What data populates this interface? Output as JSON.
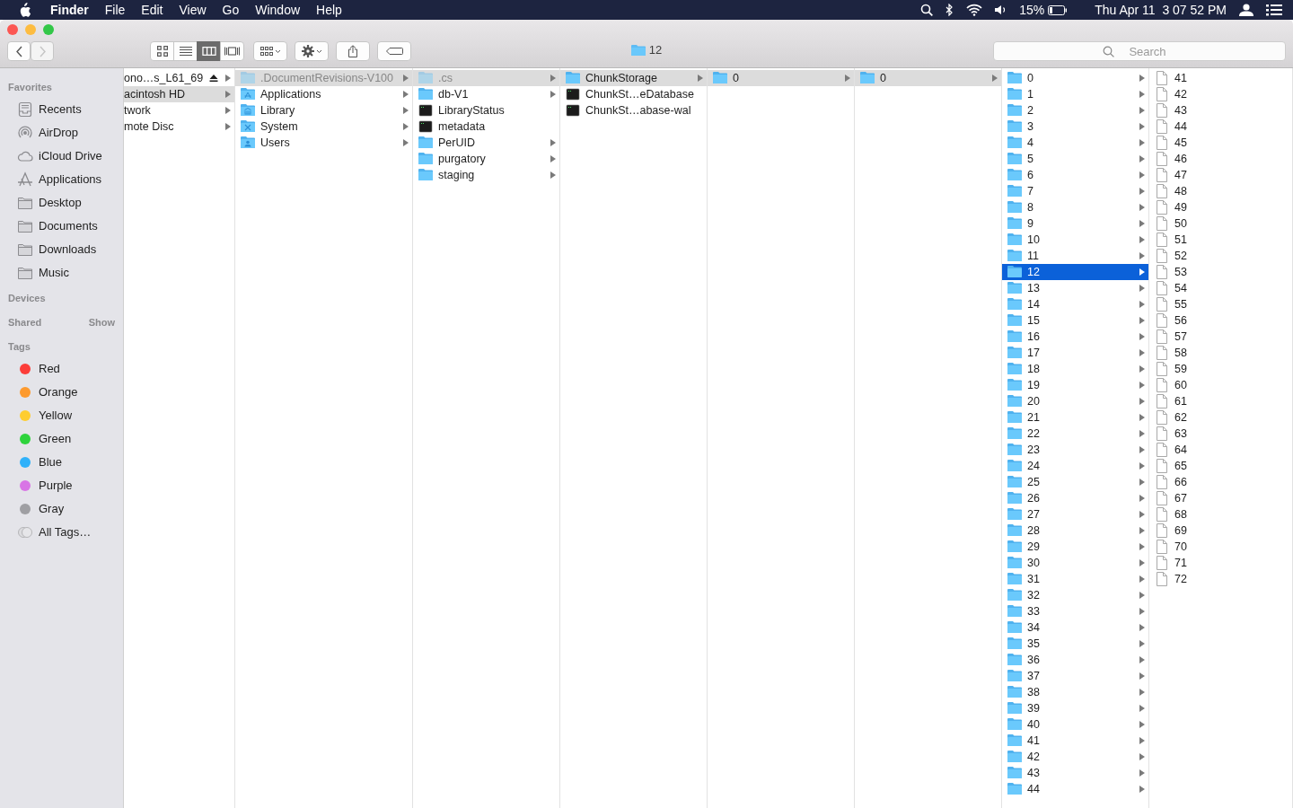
{
  "menu_bar": {
    "app": "Finder",
    "menus": [
      "File",
      "Edit",
      "View",
      "Go",
      "Window",
      "Help"
    ],
    "battery_percent": "15%",
    "clock": "Thu Apr 11  3 07 52 PM"
  },
  "window": {
    "title": "12",
    "nav_buttons": [
      {
        "kind": "back",
        "disabled": false
      },
      {
        "kind": "forward",
        "disabled": true
      }
    ],
    "view_modes": [
      {
        "kind": "icon",
        "selected": false
      },
      {
        "kind": "list",
        "selected": false
      },
      {
        "kind": "column",
        "selected": true
      },
      {
        "kind": "cover",
        "selected": false
      }
    ],
    "search": {
      "placeholder": "Search"
    }
  },
  "sidebar": {
    "sections": [
      {
        "title": "Favorites",
        "items": [
          {
            "label": "Recents",
            "kind": "recents"
          },
          {
            "label": "AirDrop",
            "kind": "airdrop"
          },
          {
            "label": "iCloud Drive",
            "kind": "cloud"
          },
          {
            "label": "Applications",
            "kind": "apps"
          },
          {
            "label": "Desktop",
            "kind": "folder"
          },
          {
            "label": "Documents",
            "kind": "folder"
          },
          {
            "label": "Downloads",
            "kind": "folder"
          },
          {
            "label": "Music",
            "kind": "folder"
          }
        ]
      },
      {
        "title": "Devices"
      },
      {
        "title": "Shared",
        "action": "Show"
      },
      {
        "title": "Tags",
        "items": [
          {
            "label": "Red",
            "kind": "tag",
            "color": "#fc3d39"
          },
          {
            "label": "Orange",
            "kind": "tag",
            "color": "#fd9a2e"
          },
          {
            "label": "Yellow",
            "kind": "tag",
            "color": "#fecd30"
          },
          {
            "label": "Green",
            "kind": "tag",
            "color": "#2ed33c"
          },
          {
            "label": "Blue",
            "kind": "tag",
            "color": "#2fb1fa"
          },
          {
            "label": "Purple",
            "kind": "tag",
            "color": "#d875e5"
          },
          {
            "label": "Gray",
            "kind": "tag",
            "color": "#9f9fa3"
          },
          {
            "label": "All Tags…",
            "kind": "all-tags"
          }
        ]
      }
    ]
  },
  "columns": [
    {
      "active": false,
      "items": [
        {
          "name": "ono…s_L61_69",
          "kind": "volume",
          "arrow": true,
          "selected": false,
          "eject": true
        },
        {
          "name": "acintosh HD",
          "kind": "volume",
          "arrow": true,
          "selected": true,
          "eject": false
        },
        {
          "name": "twork",
          "kind": "volume",
          "arrow": true,
          "selected": false,
          "eject": false
        },
        {
          "name": "mote Disc",
          "kind": "volume",
          "arrow": true,
          "selected": false,
          "eject": false
        }
      ]
    },
    {
      "active": false,
      "items": [
        {
          "name": ".DocumentRevisions-V100",
          "kind": "folder",
          "arrow": true,
          "selected": true,
          "dimmed": true
        },
        {
          "name": "Applications",
          "kind": "apps-folder",
          "arrow": true,
          "selected": false,
          "dimmed": false
        },
        {
          "name": "Library",
          "kind": "library-folder",
          "arrow": true,
          "selected": false,
          "dimmed": false
        },
        {
          "name": "System",
          "kind": "system-folder",
          "arrow": true,
          "selected": false,
          "dimmed": false
        },
        {
          "name": "Users",
          "kind": "users-folder",
          "arrow": true,
          "selected": false,
          "dimmed": false
        }
      ]
    },
    {
      "active": false,
      "items": [
        {
          "name": ".cs",
          "kind": "folder",
          "arrow": true,
          "selected": true,
          "dimmed": true
        },
        {
          "name": "db-V1",
          "kind": "folder",
          "arrow": true,
          "selected": false,
          "dimmed": false
        },
        {
          "name": "LibraryStatus",
          "kind": "exec",
          "arrow": false,
          "selected": false,
          "dimmed": false
        },
        {
          "name": "metadata",
          "kind": "exec",
          "arrow": false,
          "selected": false,
          "dimmed": false
        },
        {
          "name": "PerUID",
          "kind": "folder",
          "arrow": true,
          "selected": false,
          "dimmed": false
        },
        {
          "name": "purgatory",
          "kind": "folder",
          "arrow": true,
          "selected": false,
          "dimmed": false
        },
        {
          "name": "staging",
          "kind": "folder",
          "arrow": true,
          "selected": false,
          "dimmed": false
        }
      ]
    },
    {
      "active": false,
      "items": [
        {
          "name": "ChunkStorage",
          "kind": "folder",
          "arrow": true,
          "selected": true
        },
        {
          "name": "ChunkSt…eDatabase",
          "kind": "exec",
          "arrow": false,
          "selected": false
        },
        {
          "name": "ChunkSt…abase-wal",
          "kind": "exec",
          "arrow": false,
          "selected": false
        }
      ]
    },
    {
      "active": false,
      "items": [
        {
          "name": "0",
          "kind": "folder",
          "arrow": true,
          "selected": true
        }
      ]
    },
    {
      "active": false,
      "items": [
        {
          "name": "0",
          "kind": "folder",
          "arrow": true,
          "selected": true
        }
      ]
    },
    {
      "active": true,
      "items": [
        {
          "name": "0",
          "kind": "folder",
          "arrow": true,
          "selected": false
        },
        {
          "name": "1",
          "kind": "folder",
          "arrow": true,
          "selected": false
        },
        {
          "name": "2",
          "kind": "folder",
          "arrow": true,
          "selected": false
        },
        {
          "name": "3",
          "kind": "folder",
          "arrow": true,
          "selected": false
        },
        {
          "name": "4",
          "kind": "folder",
          "arrow": true,
          "selected": false
        },
        {
          "name": "5",
          "kind": "folder",
          "arrow": true,
          "selected": false
        },
        {
          "name": "6",
          "kind": "folder",
          "arrow": true,
          "selected": false
        },
        {
          "name": "7",
          "kind": "folder",
          "arrow": true,
          "selected": false
        },
        {
          "name": "8",
          "kind": "folder",
          "arrow": true,
          "selected": false
        },
        {
          "name": "9",
          "kind": "folder",
          "arrow": true,
          "selected": false
        },
        {
          "name": "10",
          "kind": "folder",
          "arrow": true,
          "selected": false
        },
        {
          "name": "11",
          "kind": "folder",
          "arrow": true,
          "selected": false
        },
        {
          "name": "12",
          "kind": "folder",
          "arrow": true,
          "selected": true
        },
        {
          "name": "13",
          "kind": "folder",
          "arrow": true,
          "selected": false
        },
        {
          "name": "14",
          "kind": "folder",
          "arrow": true,
          "selected": false
        },
        {
          "name": "15",
          "kind": "folder",
          "arrow": true,
          "selected": false
        },
        {
          "name": "16",
          "kind": "folder",
          "arrow": true,
          "selected": false
        },
        {
          "name": "17",
          "kind": "folder",
          "arrow": true,
          "selected": false
        },
        {
          "name": "18",
          "kind": "folder",
          "arrow": true,
          "selected": false
        },
        {
          "name": "19",
          "kind": "folder",
          "arrow": true,
          "selected": false
        },
        {
          "name": "20",
          "kind": "folder",
          "arrow": true,
          "selected": false
        },
        {
          "name": "21",
          "kind": "folder",
          "arrow": true,
          "selected": false
        },
        {
          "name": "22",
          "kind": "folder",
          "arrow": true,
          "selected": false
        },
        {
          "name": "23",
          "kind": "folder",
          "arrow": true,
          "selected": false
        },
        {
          "name": "24",
          "kind": "folder",
          "arrow": true,
          "selected": false
        },
        {
          "name": "25",
          "kind": "folder",
          "arrow": true,
          "selected": false
        },
        {
          "name": "26",
          "kind": "folder",
          "arrow": true,
          "selected": false
        },
        {
          "name": "27",
          "kind": "folder",
          "arrow": true,
          "selected": false
        },
        {
          "name": "28",
          "kind": "folder",
          "arrow": true,
          "selected": false
        },
        {
          "name": "29",
          "kind": "folder",
          "arrow": true,
          "selected": false
        },
        {
          "name": "30",
          "kind": "folder",
          "arrow": true,
          "selected": false
        },
        {
          "name": "31",
          "kind": "folder",
          "arrow": true,
          "selected": false
        },
        {
          "name": "32",
          "kind": "folder",
          "arrow": true,
          "selected": false
        },
        {
          "name": "33",
          "kind": "folder",
          "arrow": true,
          "selected": false
        },
        {
          "name": "34",
          "kind": "folder",
          "arrow": true,
          "selected": false
        },
        {
          "name": "35",
          "kind": "folder",
          "arrow": true,
          "selected": false
        },
        {
          "name": "36",
          "kind": "folder",
          "arrow": true,
          "selected": false
        },
        {
          "name": "37",
          "kind": "folder",
          "arrow": true,
          "selected": false
        },
        {
          "name": "38",
          "kind": "folder",
          "arrow": true,
          "selected": false
        },
        {
          "name": "39",
          "kind": "folder",
          "arrow": true,
          "selected": false
        },
        {
          "name": "40",
          "kind": "folder",
          "arrow": true,
          "selected": false
        },
        {
          "name": "41",
          "kind": "folder",
          "arrow": true,
          "selected": false
        },
        {
          "name": "42",
          "kind": "folder",
          "arrow": true,
          "selected": false
        },
        {
          "name": "43",
          "kind": "folder",
          "arrow": true,
          "selected": false
        },
        {
          "name": "44",
          "kind": "folder",
          "arrow": true,
          "selected": false
        }
      ]
    },
    {
      "items": [
        {
          "name": "41",
          "kind": "file",
          "arrow": false,
          "selected": false
        },
        {
          "name": "42",
          "kind": "file",
          "arrow": false,
          "selected": false
        },
        {
          "name": "43",
          "kind": "file",
          "arrow": false,
          "selected": false
        },
        {
          "name": "44",
          "kind": "file",
          "arrow": false,
          "selected": false
        },
        {
          "name": "45",
          "kind": "file",
          "arrow": false,
          "selected": false
        },
        {
          "name": "46",
          "kind": "file",
          "arrow": false,
          "selected": false
        },
        {
          "name": "47",
          "kind": "file",
          "arrow": false,
          "selected": false
        },
        {
          "name": "48",
          "kind": "file",
          "arrow": false,
          "selected": false
        },
        {
          "name": "49",
          "kind": "file",
          "arrow": false,
          "selected": false
        },
        {
          "name": "50",
          "kind": "file",
          "arrow": false,
          "selected": false
        },
        {
          "name": "51",
          "kind": "file",
          "arrow": false,
          "selected": false
        },
        {
          "name": "52",
          "kind": "file",
          "arrow": false,
          "selected": false
        },
        {
          "name": "53",
          "kind": "file",
          "arrow": false,
          "selected": false
        },
        {
          "name": "54",
          "kind": "file",
          "arrow": false,
          "selected": false
        },
        {
          "name": "55",
          "kind": "file",
          "arrow": false,
          "selected": false
        },
        {
          "name": "56",
          "kind": "file",
          "arrow": false,
          "selected": false
        },
        {
          "name": "57",
          "kind": "file",
          "arrow": false,
          "selected": false
        },
        {
          "name": "58",
          "kind": "file",
          "arrow": false,
          "selected": false
        },
        {
          "name": "59",
          "kind": "file",
          "arrow": false,
          "selected": false
        },
        {
          "name": "60",
          "kind": "file",
          "arrow": false,
          "selected": false
        },
        {
          "name": "61",
          "kind": "file",
          "arrow": false,
          "selected": false
        },
        {
          "name": "62",
          "kind": "file",
          "arrow": false,
          "selected": false
        },
        {
          "name": "63",
          "kind": "file",
          "arrow": false,
          "selected": false
        },
        {
          "name": "64",
          "kind": "file",
          "arrow": false,
          "selected": false
        },
        {
          "name": "65",
          "kind": "file",
          "arrow": false,
          "selected": false
        },
        {
          "name": "66",
          "kind": "file",
          "arrow": false,
          "selected": false
        },
        {
          "name": "67",
          "kind": "file",
          "arrow": false,
          "selected": false
        },
        {
          "name": "68",
          "kind": "file",
          "arrow": false,
          "selected": false
        },
        {
          "name": "69",
          "kind": "file",
          "arrow": false,
          "selected": false
        },
        {
          "name": "70",
          "kind": "file",
          "arrow": false,
          "selected": false
        },
        {
          "name": "71",
          "kind": "file",
          "arrow": false,
          "selected": false
        },
        {
          "name": "72",
          "kind": "file",
          "arrow": false,
          "selected": false
        }
      ]
    }
  ]
}
